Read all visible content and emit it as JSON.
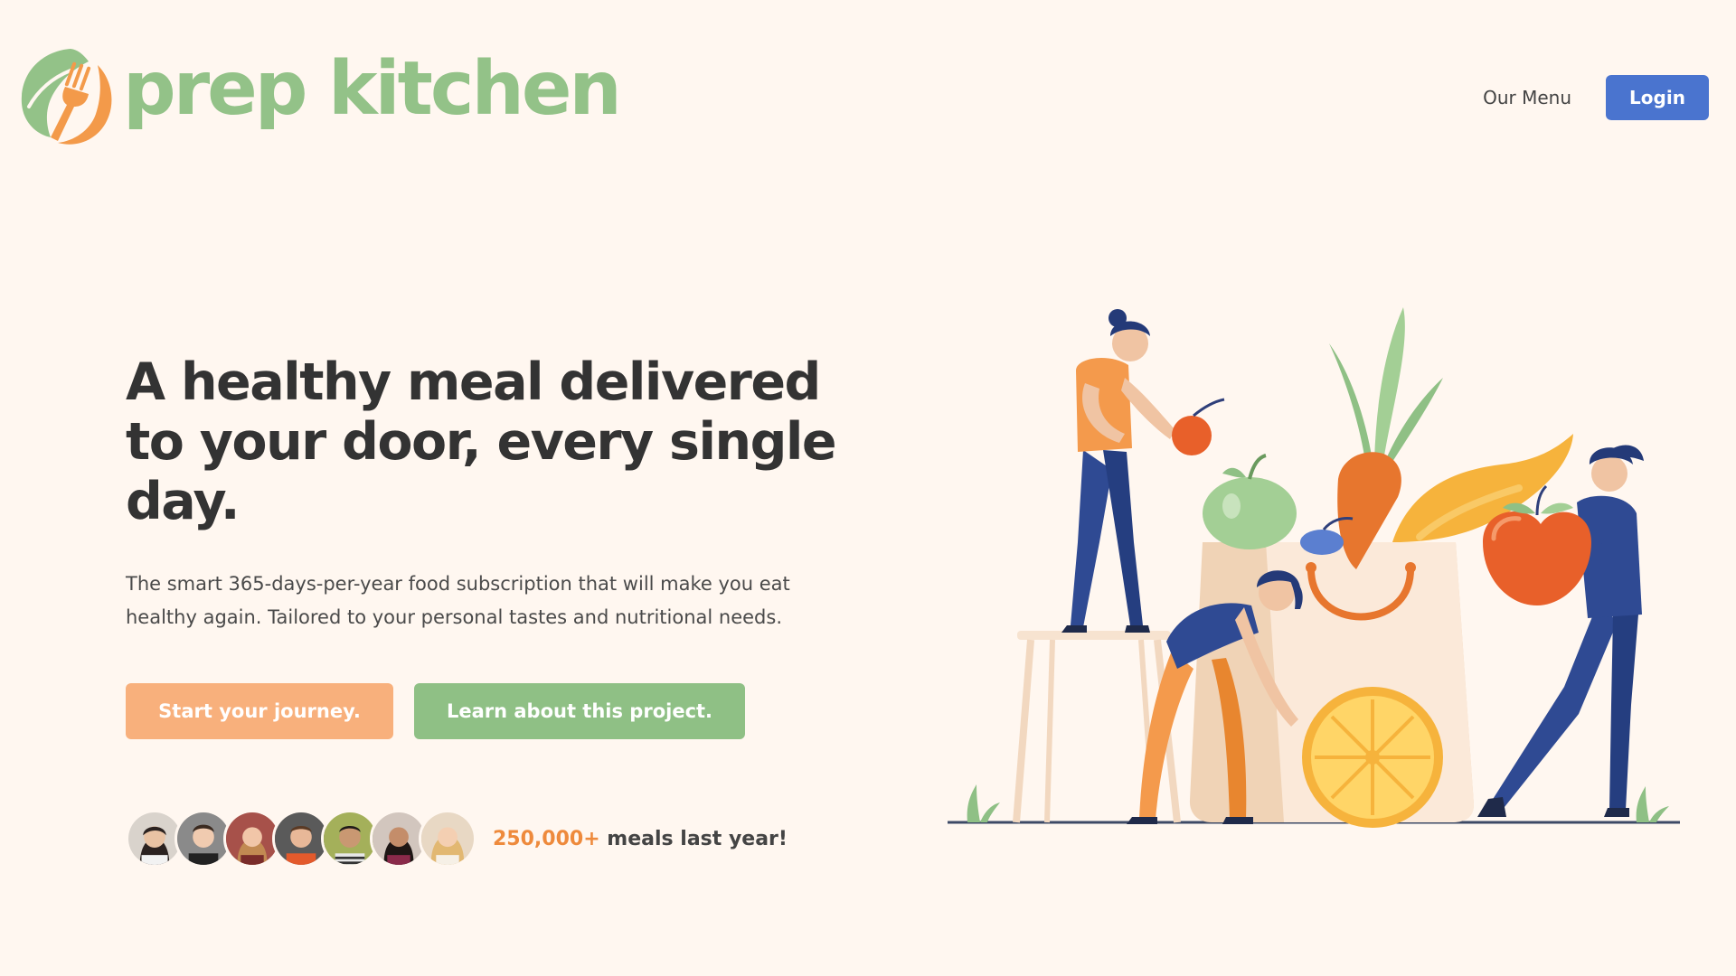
{
  "brand": {
    "name": "prep kitchen",
    "color": "#93c288",
    "accent": "#ee8a3c"
  },
  "nav": {
    "menu_label": "Our Menu",
    "login_label": "Login",
    "login_color": "#4a74cf"
  },
  "hero": {
    "title": "A healthy meal delivered to your door, every single day.",
    "subtitle": "The smart 365-days-per-year food subscription that will make you eat healthy again. Tailored to your personal tastes and nutritional needs.",
    "cta_primary": "Start your journey.",
    "cta_secondary": "Learn about this project.",
    "cta_primary_color": "#f8b07c",
    "cta_secondary_color": "#8fc085"
  },
  "social_proof": {
    "count": "250,000+",
    "text": " meals last year!",
    "avatars": [
      {
        "icon": "customer-avatar-1"
      },
      {
        "icon": "customer-avatar-2"
      },
      {
        "icon": "customer-avatar-3"
      },
      {
        "icon": "customer-avatar-4"
      },
      {
        "icon": "customer-avatar-5"
      },
      {
        "icon": "customer-avatar-6"
      },
      {
        "icon": "customer-avatar-7"
      }
    ]
  },
  "illustration": {
    "icon": "grocery-shopping-illustration"
  }
}
